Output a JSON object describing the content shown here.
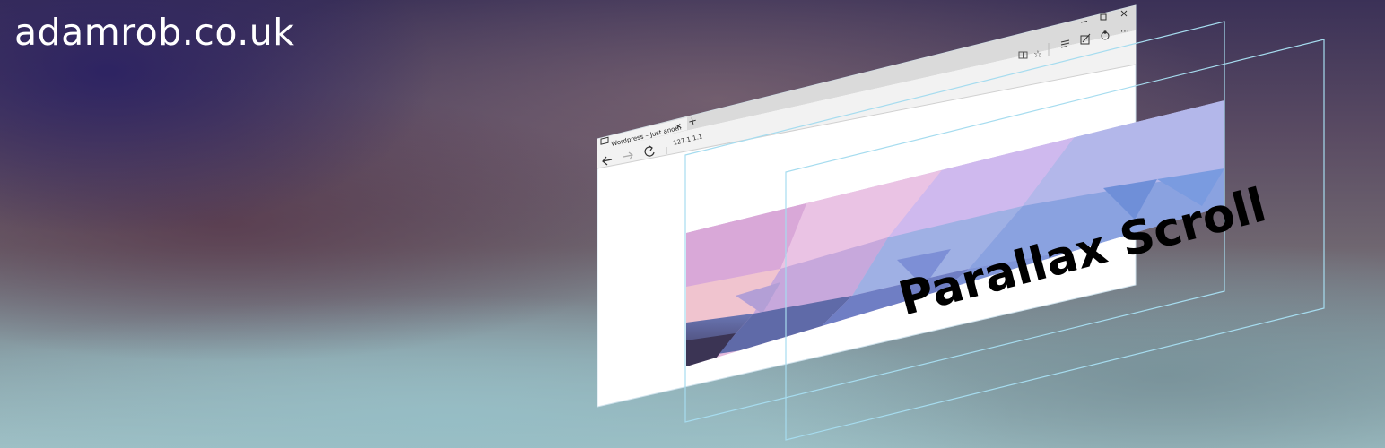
{
  "site": {
    "title": "adamrob.co.uk"
  },
  "browser": {
    "tab_title": "Wordpress – Just anoth",
    "address": "127.1.1.1",
    "new_tab_glyph": "+",
    "tab_close_glyph": "×",
    "icons": [
      "tab-page-icon",
      "back-arrow-icon",
      "forward-arrow-icon",
      "refresh-icon",
      "reading-view-icon",
      "favorite-star-icon",
      "hub-icon",
      "web-note-icon",
      "share-icon",
      "more-icon",
      "minimize-icon",
      "maximize-icon",
      "close-icon"
    ]
  },
  "hero": {
    "title": "Parallax Scroll"
  },
  "colors": {
    "frame_outline": "#a6dcef",
    "chrome_bar": "#d9d9d9",
    "address_bar": "#f2f2f2",
    "title_text": "#000000",
    "site_title_text": "#ffffff"
  }
}
